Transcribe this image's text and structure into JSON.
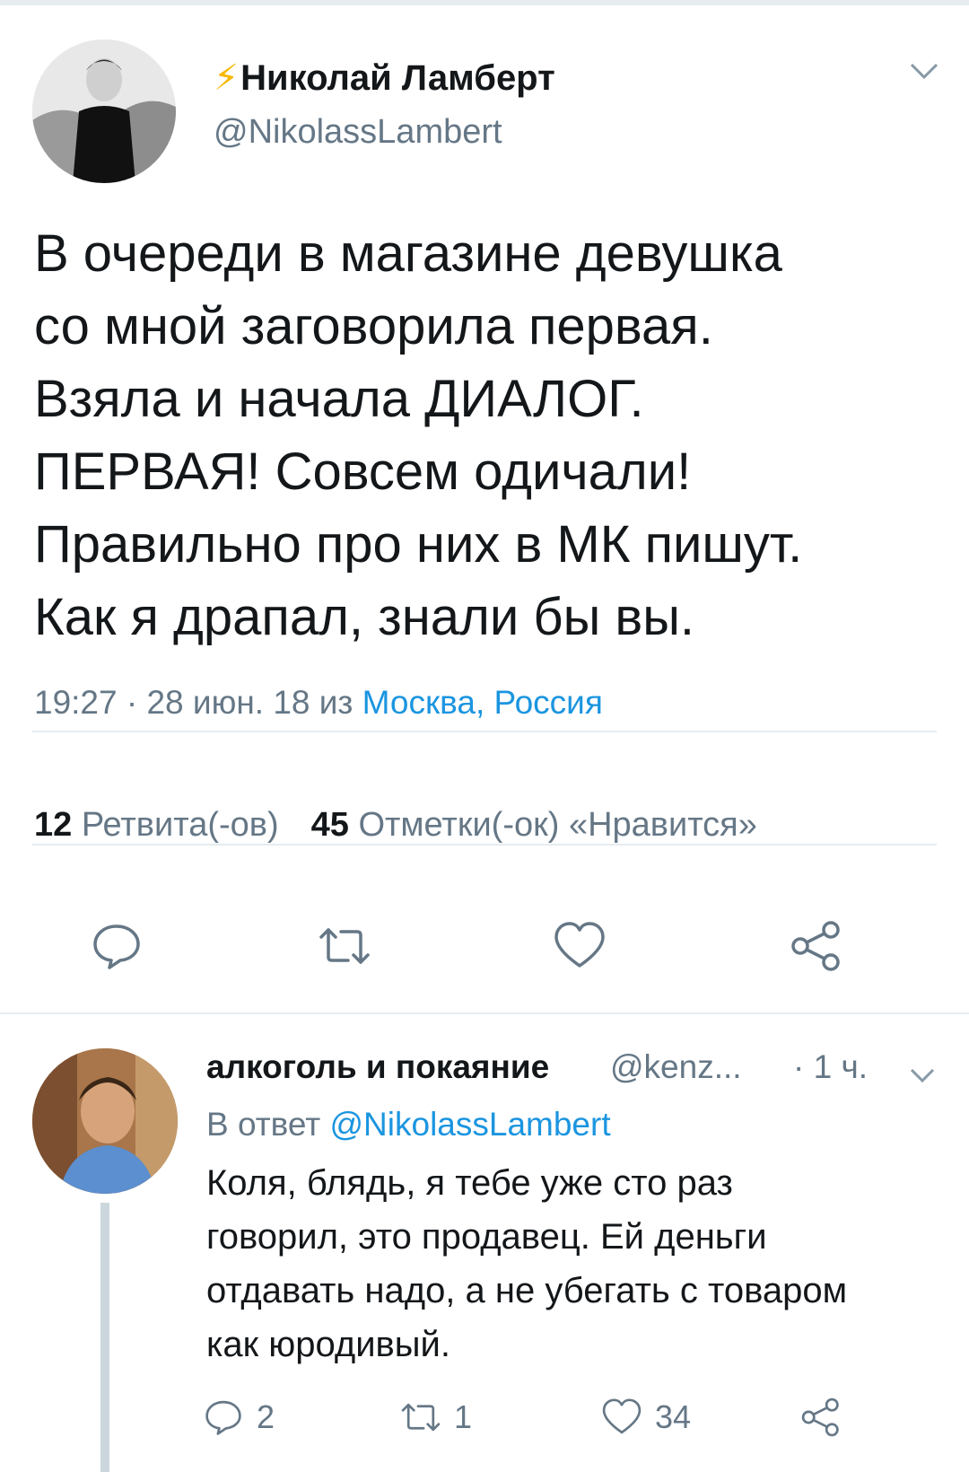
{
  "tweet": {
    "author_name": "Николай Ламберт",
    "author_handle": "@NikolassLambert",
    "text": "В очереди в магазине девушка\nсо мной заговорила первая.\nВзяла и начала ДИАЛОГ.\nПЕРВАЯ! Совсем одичали!\nПравильно про них в МК пишут.\nКак я драпал, знали бы вы.",
    "time": "19:27 · 28 июн. 18 из",
    "location": "Москва, Россия",
    "retweet_count": "12",
    "retweet_label": "Ретвита(-ов)",
    "like_count": "45",
    "like_label": "Отметки(-ок) «Нравится»",
    "icons": [
      "bolt-icon",
      "chevron-down-icon",
      "reply-icon",
      "retweet-icon",
      "like-icon",
      "share-icon"
    ]
  },
  "reply": {
    "author_name": "алкоголь и покаяние",
    "author_handle": "@kenz...",
    "time": "· 1 ч.",
    "reply_prefix": "В ответ",
    "reply_mention": "@NikolassLambert",
    "text": "Коля, блядь, я тебе уже сто раз\nговорил, это продавец. Ей деньги\nотдавать надо, а не убегать с товаром\nкак юродивый.",
    "reply_count": "2",
    "retweet_count": "1",
    "like_count": "34"
  },
  "colors": {
    "text": "#14171a",
    "secondary": "#657786",
    "link": "#1b95e0",
    "divider": "#e6ecf0",
    "bolt": "#f5b800"
  }
}
